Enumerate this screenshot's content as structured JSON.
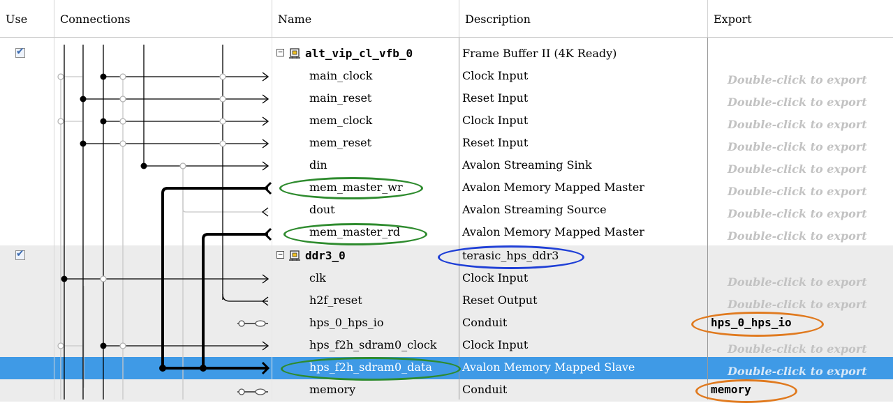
{
  "headers": {
    "use": "Use",
    "connections": "Connections",
    "name": "Name",
    "description": "Description",
    "export": "Export"
  },
  "export_hint": "Double-click to export",
  "rows": [
    {
      "name": "alt_vip_cl_vfb_0",
      "description": "Frame Buffer II (4K Ready)",
      "export": ""
    },
    {
      "name": "main_clock",
      "description": "Clock Input",
      "export": "Double-click to export"
    },
    {
      "name": "main_reset",
      "description": "Reset Input",
      "export": "Double-click to export"
    },
    {
      "name": "mem_clock",
      "description": "Clock Input",
      "export": "Double-click to export"
    },
    {
      "name": "mem_reset",
      "description": "Reset Input",
      "export": "Double-click to export"
    },
    {
      "name": "din",
      "description": "Avalon Streaming Sink",
      "export": "Double-click to export"
    },
    {
      "name": "mem_master_wr",
      "description": "Avalon Memory Mapped Master",
      "export": "Double-click to export"
    },
    {
      "name": "dout",
      "description": "Avalon Streaming Source",
      "export": "Double-click to export"
    },
    {
      "name": "mem_master_rd",
      "description": "Avalon Memory Mapped Master",
      "export": "Double-click to export"
    },
    {
      "name": "ddr3_0",
      "description": "terasic_hps_ddr3",
      "export": ""
    },
    {
      "name": "clk",
      "description": "Clock Input",
      "export": "Double-click to export"
    },
    {
      "name": "h2f_reset",
      "description": "Reset Output",
      "export": "Double-click to export"
    },
    {
      "name": "hps_0_hps_io",
      "description": "Conduit",
      "export": "hps_0_hps_io"
    },
    {
      "name": "hps_f2h_sdram0_clock",
      "description": "Clock Input",
      "export": "Double-click to export"
    },
    {
      "name": "hps_f2h_sdram0_data",
      "description": "Avalon Memory Mapped Slave",
      "export": "Double-click to export"
    },
    {
      "name": "memory",
      "description": "Conduit",
      "export": "memory"
    }
  ],
  "icons": {
    "checkbox": "checkbox-checked-icon",
    "expander": "collapse-minus-icon",
    "component": "component-chip-icon"
  },
  "colors": {
    "selected_row": "#3f9ae6",
    "component_row": "#ececec",
    "annotation_green": "#2e8b2e",
    "annotation_blue": "#1f3fd6",
    "annotation_orange": "#e07a1f"
  }
}
